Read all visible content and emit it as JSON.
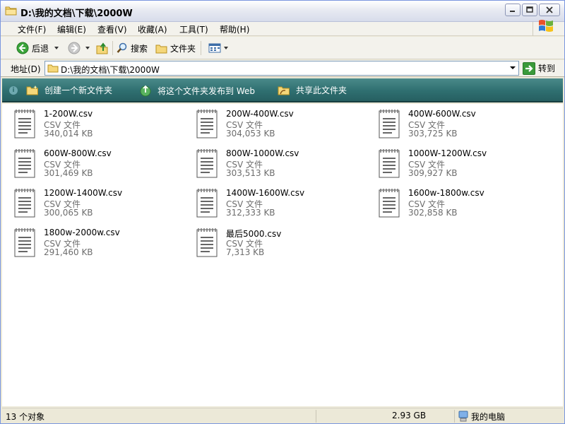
{
  "window": {
    "title": "D:\\我的文档\\下载\\2000W"
  },
  "menu": {
    "items": [
      "文件(F)",
      "编辑(E)",
      "查看(V)",
      "收藏(A)",
      "工具(T)",
      "帮助(H)"
    ]
  },
  "toolbar": {
    "back_label": "后退",
    "search_label": "搜索",
    "folders_label": "文件夹"
  },
  "address": {
    "label": "地址(D)",
    "value": "D:\\我的文档\\下载\\2000W",
    "go_label": "转到"
  },
  "tasks": {
    "new_folder": "创建一个新文件夹",
    "publish_web": "将这个文件夹发布到 Web",
    "share": "共享此文件夹"
  },
  "files": [
    {
      "name": "1-200W.csv",
      "type": "CSV 文件",
      "size": "340,014 KB"
    },
    {
      "name": "200W-400W.csv",
      "type": "CSV 文件",
      "size": "304,053 KB"
    },
    {
      "name": "400W-600W.csv",
      "type": "CSV 文件",
      "size": "303,725 KB"
    },
    {
      "name": "600W-800W.csv",
      "type": "CSV 文件",
      "size": "301,469 KB"
    },
    {
      "name": "800W-1000W.csv",
      "type": "CSV 文件",
      "size": "303,513 KB"
    },
    {
      "name": "1000W-1200W.csv",
      "type": "CSV 文件",
      "size": "309,927 KB"
    },
    {
      "name": "1200W-1400W.csv",
      "type": "CSV 文件",
      "size": "300,065 KB"
    },
    {
      "name": "1400W-1600W.csv",
      "type": "CSV 文件",
      "size": "312,333 KB"
    },
    {
      "name": "1600w-1800w.csv",
      "type": "CSV 文件",
      "size": "302,858 KB"
    },
    {
      "name": "1800w-2000w.csv",
      "type": "CSV 文件",
      "size": "291,460 KB"
    },
    {
      "name": "最后5000.csv",
      "type": "CSV 文件",
      "size": "7,313 KB"
    }
  ],
  "status": {
    "count": "13 个对象",
    "size": "2.93 GB",
    "location": "我的电脑"
  },
  "colors": {
    "task_strip": "#2f6f70",
    "window_bg": "#ece9d8",
    "address_border": "#7f9db9"
  }
}
